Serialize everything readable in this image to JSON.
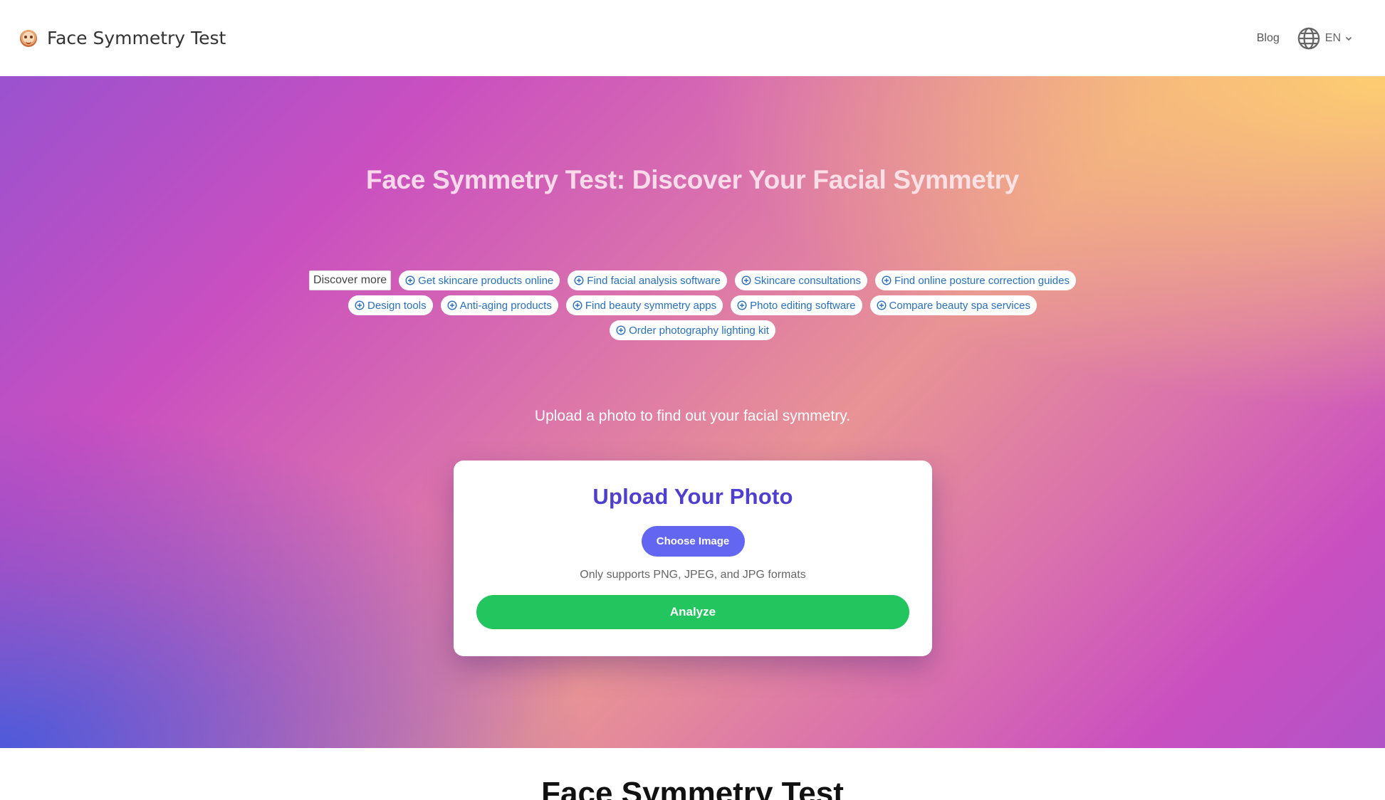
{
  "header": {
    "brand_title": "Face Symmetry Test",
    "nav_blog": "Blog",
    "language": "EN"
  },
  "hero": {
    "title": "Face Symmetry Test: Discover Your Facial Symmetry",
    "discover_label": "Discover more",
    "chips": [
      "Get skincare products online",
      "Find facial analysis software",
      "Skincare consultations",
      "Find online posture correction guides",
      "Design tools",
      "Anti-aging products",
      "Find beauty symmetry apps",
      "Photo editing software",
      "Compare beauty spa services",
      "Order photography lighting kit"
    ],
    "subtitle": "Upload a photo to find out your facial symmetry."
  },
  "upload_card": {
    "title": "Upload Your Photo",
    "choose_button": "Choose Image",
    "hint": "Only supports PNG, JPEG, and JPG formats",
    "analyze_button": "Analyze"
  },
  "section": {
    "title": "Face Symmetry Test"
  },
  "colors": {
    "accent": "#6366f1",
    "card_title": "#4f3fd0",
    "analyze": "#22c55e",
    "chip_text": "#2770c2"
  },
  "icons": {
    "brand": "face-logo-icon",
    "language": "globe-icon",
    "language_dropdown": "chevron-down-icon",
    "chip": "plus-circle-icon"
  }
}
